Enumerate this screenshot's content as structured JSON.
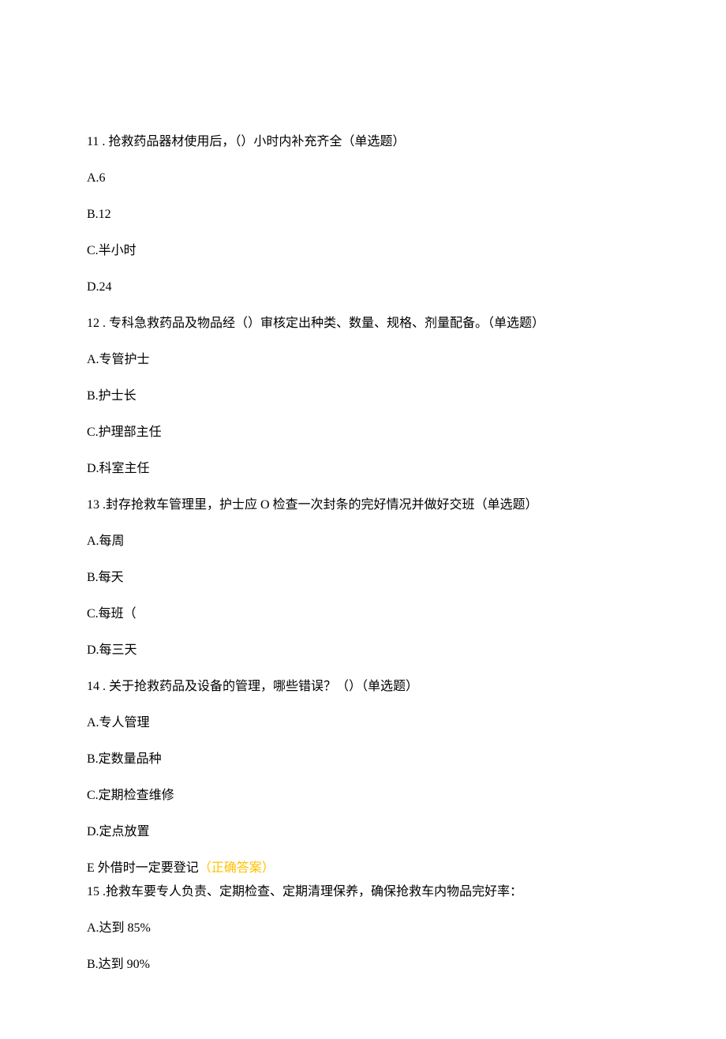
{
  "q11": {
    "number": "11",
    "text": " . 抢救药品器材使用后，（）小时内补充齐全（单选题）",
    "options": {
      "A": "A.6",
      "B": "B.12",
      "C": "C.半小时",
      "D": "D.24"
    }
  },
  "q12": {
    "number": "12",
    "text": " . 专科急救药品及物品经（）审核定出种类、数量、规格、剂量配备。（单选题）",
    "options": {
      "A": "A.专管护士",
      "B": "B.护士长",
      "C": "C.护理部主任",
      "D": "D.科室主任"
    }
  },
  "q13": {
    "number": "13",
    "text": " .封存抢救车管理里，护士应 O 检查一次封条的完好情况并做好交班（单选题）",
    "options": {
      "A": "A.每周",
      "B": "B.每天",
      "C": "C.每班（",
      "D": "D.每三天"
    }
  },
  "q14": {
    "number": "14",
    "text": " . 关于抢救药品及设备的管理，哪些错误？（）（单选题）",
    "options": {
      "A": "A.专人管理",
      "B": "B.定数量品种",
      "C": "C.定期检查维修",
      "D": "D.定点放置",
      "E_prefix": "E 外借时一定要登记",
      "E_correct": "（正确答案）"
    }
  },
  "q15": {
    "number": "15",
    "text": " .抢救车要专人负责、定期检查、定期清理保养，确保抢救车内物品完好率：",
    "options": {
      "A": "A.达到 85%",
      "B": "B.达到 90%"
    }
  }
}
